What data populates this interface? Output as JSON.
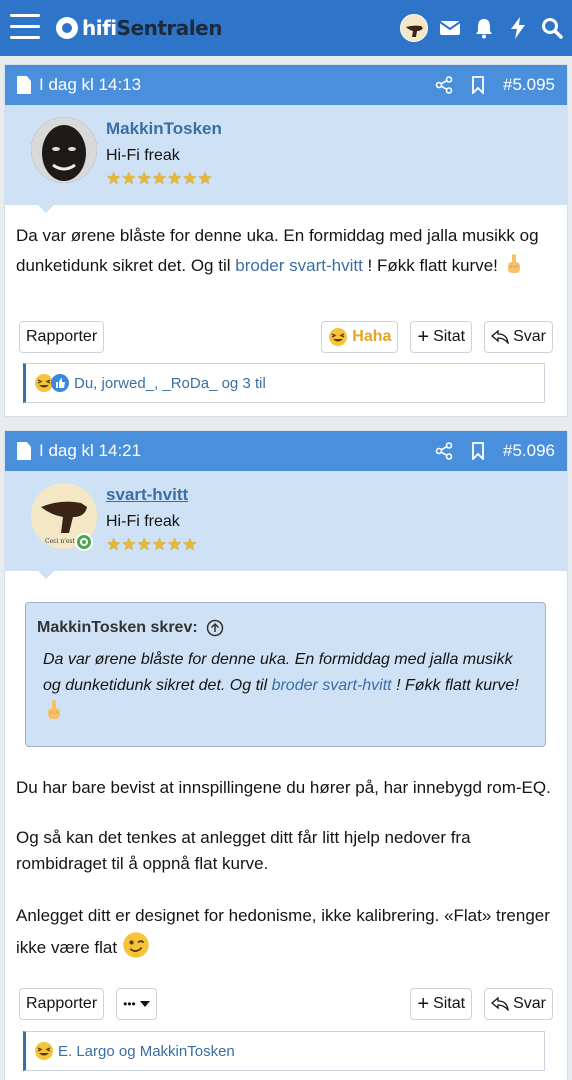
{
  "header": {
    "logo_hifi": "hifi",
    "logo_sentralen": "Sentralen"
  },
  "posts": [
    {
      "date": "I dag kl 14:13",
      "number": "#5.095",
      "author": "MakkinTosken",
      "user_title": "Hi-Fi freak",
      "stars": "★★★★★★★",
      "body_part1": "Da var ørene blåste for denne uka. En formiddag med jalla musikk og dunketidunk sikret det. Og til",
      "body_link": "broder svart-hvitt",
      "body_part2": "! Føkk flatt kurve!",
      "report_label": "Rapporter",
      "reaction_label": "Haha",
      "quote_label": "Sitat",
      "reply_label": "Svar",
      "reactions_text": "Du, jorwed_, _RoDa_ og 3 til"
    },
    {
      "date": "I dag kl 14:21",
      "number": "#5.096",
      "author": "svart-hvitt",
      "user_title": "Hi-Fi freak",
      "stars": "★★★★★★",
      "quote_author": "MakkinTosken skrev:",
      "quote_part1": "Da var ørene blåste for denne uka. En formiddag med jalla musikk og dunketidunk sikret det. Og til",
      "quote_link": "broder svart-hvitt",
      "quote_part2": "! Føkk flatt kurve!",
      "para1": "Du har bare bevist at innspillingene du hører på, har innebygd rom-EQ.",
      "para2": "Og så kan det tenkes at anlegget ditt får litt hjelp nedover fra rombidraget til å oppnå flat kurve.",
      "para3": "Anlegget ditt er designet for hedonisme, ikke kalibrering. «Flat» trenger ikke være flat",
      "report_label": "Rapporter",
      "more_label": "•••",
      "quote_label": "Sitat",
      "reply_label": "Svar",
      "reactions_text": "E. Largo og MakkinTosken"
    }
  ],
  "colors": {
    "topbar": "#2e75c9",
    "post_header": "#4a8fdc",
    "user_block": "#cfe2f5",
    "link": "#3a6ea5",
    "haha": "#e6a325"
  }
}
